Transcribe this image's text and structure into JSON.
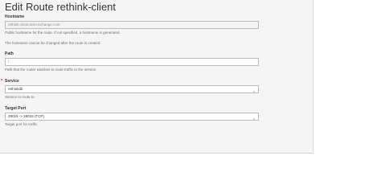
{
  "page": {
    "title": "Edit Route rethink-client"
  },
  "hostname": {
    "label": "Hostname",
    "value": "rethink-client.test.exchange.com",
    "help_public": "Public hostname for the route. If not specified, a hostname is generated.",
    "help_readonly": "The hostname cannot be changed after the route is created."
  },
  "path": {
    "label": "Path",
    "value": "/",
    "help": "Path that the router watches to route traffic to the service."
  },
  "service": {
    "required_mark": "*",
    "label": "Service",
    "selected": "rethinkdb",
    "help": "Service to route to."
  },
  "target_port": {
    "label": "Target Port",
    "selected": "28015 -> 28015 (TCP)",
    "help": "Target port for traffic."
  },
  "icons": {
    "dropdown": "chevron-down-icon"
  }
}
